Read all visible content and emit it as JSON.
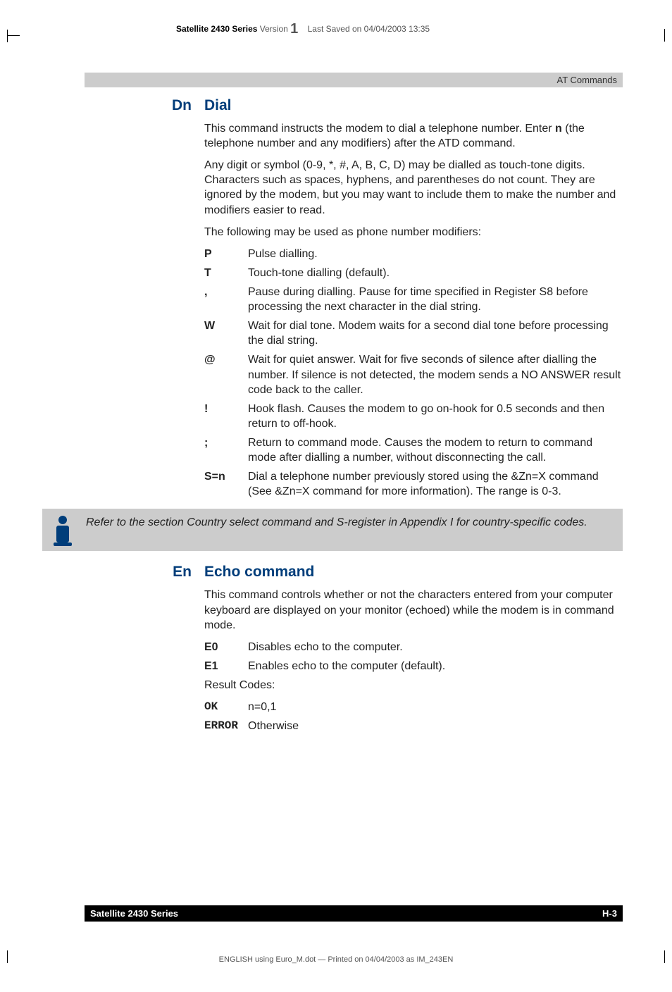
{
  "header": {
    "series": "Satellite 2430 Series",
    "version_label": "Version",
    "version_num": "1",
    "saved": "Last Saved on 04/04/2003 13:35"
  },
  "banner": "AT Commands",
  "dn": {
    "left": "Dn",
    "right": "Dial",
    "p1a": "This command instructs the modem to dial a telephone number. Enter ",
    "p1b": "n",
    "p1c": " (the telephone number and any modifiers) after the ATD command.",
    "p2": "Any digit or symbol (0-9, *, #, A, B, C, D) may be dialled as touch-tone digits. Characters such as spaces, hyphens, and parentheses do not count. They are ignored by the modem, but you may want to include them to make the number and modifiers easier to read.",
    "p3": "The following may be used as phone number modifiers:",
    "items": [
      {
        "term": "P",
        "def": "Pulse dialling."
      },
      {
        "term": "T",
        "def": "Touch-tone dialling (default)."
      },
      {
        "term": ",",
        "def": "Pause during dialling. Pause for time specified in Register S8 before processing the next character in the dial string."
      },
      {
        "term": "W",
        "def": "Wait for dial tone. Modem waits for a second dial tone before processing the dial string."
      },
      {
        "term": "@",
        "def": "Wait for quiet answer. Wait for five seconds of silence after dialling the number. If silence is not detected, the modem sends a NO ANSWER result code back to the caller."
      },
      {
        "term": "!",
        "def": "Hook flash. Causes the modem to go on-hook for 0.5 seconds and then return to off-hook."
      },
      {
        "term": ";",
        "def": "Return to command mode. Causes the modem to return to command mode after dialling a number, without disconnecting the call."
      },
      {
        "term": "S=n",
        "def": "Dial a telephone number previously stored using the &Zn=X command (See &Zn=X command for more information). The range is 0-3."
      }
    ]
  },
  "note": "Refer to the section Country select command and S-register in Appendix I for country-specific codes.",
  "en": {
    "left": "En",
    "right": "Echo command",
    "p1": "This command controls whether or not the characters entered from your computer keyboard are displayed on your monitor (echoed) while the modem is in command mode.",
    "items": [
      {
        "term": "E0",
        "def": "Disables echo to the computer."
      },
      {
        "term": "E1",
        "def": "Enables echo to the computer (default)."
      }
    ],
    "result_label": "Result Codes:",
    "results": [
      {
        "term": "OK",
        "def": "n=0,1"
      },
      {
        "term": "ERROR",
        "def": "Otherwise"
      }
    ]
  },
  "footer": {
    "left": "Satellite 2430 Series",
    "right": "H-3"
  },
  "printline": "ENGLISH using  Euro_M.dot — Printed on 04/04/2003 as IM_243EN"
}
